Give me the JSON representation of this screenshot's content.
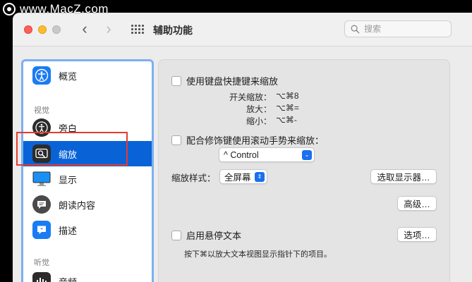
{
  "watermark": "www.MacZ.com",
  "titlebar": {
    "title": "辅助功能",
    "back_glyph": "‹",
    "forward_glyph": "›",
    "search_placeholder": "搜索"
  },
  "sidebar": {
    "items": [
      {
        "label": "概览",
        "icon": "accessibility-icon",
        "color": "#1a7cf2"
      },
      {
        "label": "旁白",
        "icon": "voiceover-icon",
        "color": "#2b2b2b"
      },
      {
        "label": "缩放",
        "icon": "zoom-icon",
        "color": "#2b2b2b"
      },
      {
        "label": "显示",
        "icon": "display-icon",
        "color": "#1a90f5"
      },
      {
        "label": "朗读内容",
        "icon": "spoken-content-icon",
        "color": "#4a4a4a"
      },
      {
        "label": "描述",
        "icon": "descriptions-icon",
        "color": "#1a7cf2"
      },
      {
        "label": "音频",
        "icon": "audio-icon",
        "color": "#2b2b2b"
      }
    ],
    "sections": {
      "vision": "视觉",
      "hearing": "听觉"
    },
    "selected_index": 2
  },
  "content": {
    "keyboard_shortcuts": {
      "label": "使用键盘快捷键来缩放",
      "checked": false,
      "shortcuts": [
        {
          "label": "开关缩放：",
          "keys": "⌥⌘8"
        },
        {
          "label": "放大：",
          "keys": "⌥⌘="
        },
        {
          "label": "缩小：",
          "keys": "⌥⌘-"
        }
      ]
    },
    "scroll_gesture": {
      "label": "配合修饰键使用滚动手势来缩放：",
      "checked": false,
      "modifier_value": "^ Control"
    },
    "zoom_style": {
      "label": "缩放样式：",
      "value": "全屏幕"
    },
    "select_display_button": "选取显示器…",
    "advanced_button": "高级…",
    "hover_text": {
      "label": "启用悬停文本",
      "checked": false,
      "options_button": "选项…",
      "note": "按下⌘以放大文本视图显示指针下的项目。"
    }
  }
}
